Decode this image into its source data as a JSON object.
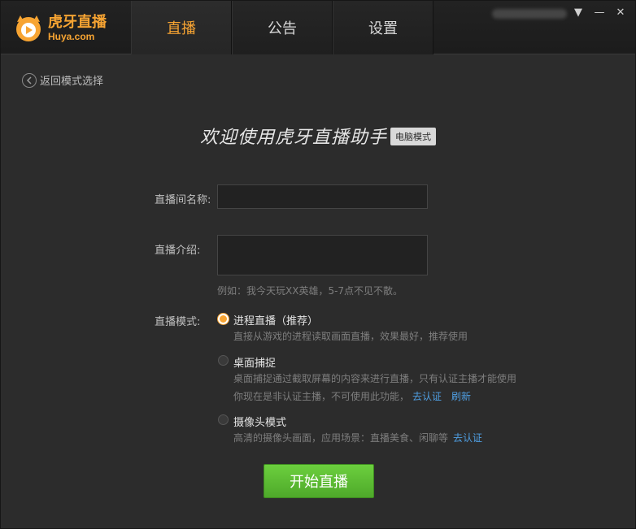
{
  "app": {
    "logo_cn": "虎牙直播",
    "logo_en": "Huya.com"
  },
  "tabs": [
    {
      "label": "直播",
      "active": true
    },
    {
      "label": "公告",
      "active": false
    },
    {
      "label": "设置",
      "active": false
    }
  ],
  "window_controls": {
    "menu": "▼",
    "minimize": "—",
    "close": "✕"
  },
  "back": {
    "label": "返回模式选择"
  },
  "header": {
    "title": "欢迎使用虎牙直播助手",
    "badge": "电脑模式"
  },
  "form": {
    "room_name_label": "直播间名称:",
    "room_name_value": "",
    "intro_label": "直播介绍:",
    "intro_value": "",
    "intro_hint": "例如：我今天玩XX英雄，5-7点不见不散。",
    "mode_label": "直播模式:"
  },
  "modes": [
    {
      "title": "进程直播（推荐）",
      "desc": "直接从游戏的进程读取画面直播，效果最好，推荐使用",
      "checked": true
    },
    {
      "title": "桌面捕捉",
      "desc": "桌面捕捉通过截取屏幕的内容来进行直播，只有认证主播才能使用",
      "desc2": "你现在是非认证主播，不可使用此功能，",
      "link1": "去认证",
      "link2": "刷新",
      "checked": false
    },
    {
      "title": "摄像头模式",
      "desc": "高清的摄像头画面，应用场景：直播美食、闲聊等",
      "link1": "去认证",
      "checked": false
    }
  ],
  "start_button": {
    "label": "开始直播"
  },
  "colors": {
    "accent": "#f7a432",
    "link": "#4f9fe3",
    "start": "#5cbf33",
    "background": "#2c2c2c"
  }
}
